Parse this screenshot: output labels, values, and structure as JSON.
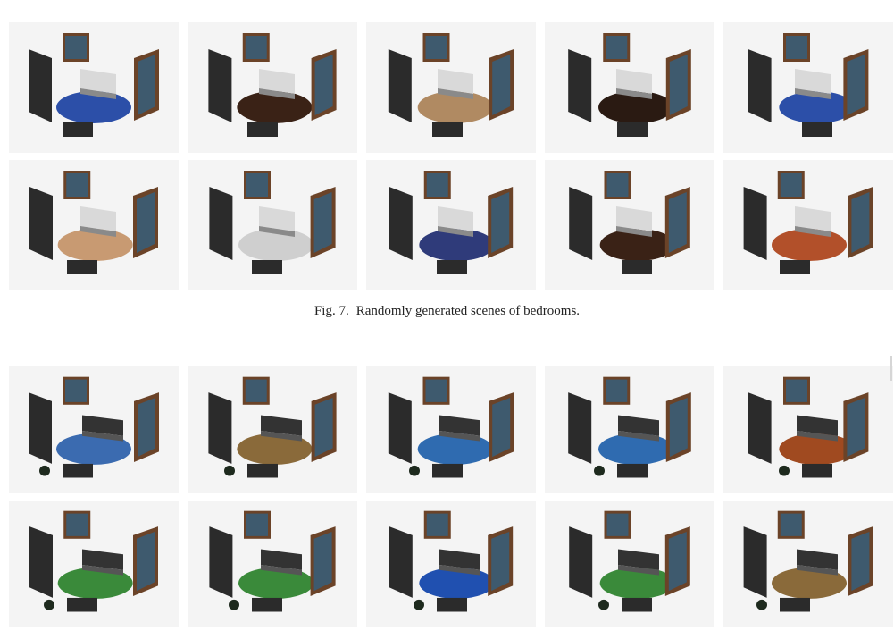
{
  "figure7": {
    "label": "Fig. 7.",
    "caption": "Randomly generated scenes of bedrooms.",
    "thumbnails": [
      {
        "scene": "bedroom",
        "rug": "#2c4fa8"
      },
      {
        "scene": "bedroom",
        "rug": "#3a2216"
      },
      {
        "scene": "bedroom",
        "rug": "#b08a62"
      },
      {
        "scene": "bedroom",
        "rug": "#2a1a12"
      },
      {
        "scene": "bedroom",
        "rug": "#2c4fa8"
      },
      {
        "scene": "bedroom",
        "rug": "#c89a72"
      },
      {
        "scene": "bedroom",
        "rug": "#cfcfcf"
      },
      {
        "scene": "bedroom",
        "rug": "#2f3b7a"
      },
      {
        "scene": "bedroom",
        "rug": "#3a2216"
      },
      {
        "scene": "bedroom",
        "rug": "#b2502a"
      }
    ]
  },
  "figure8": {
    "thumbnails": [
      {
        "scene": "living-room",
        "rug": "#3b6bb0"
      },
      {
        "scene": "living-room",
        "rug": "#8a6a3a"
      },
      {
        "scene": "living-room",
        "rug": "#2f6bb0"
      },
      {
        "scene": "living-room",
        "rug": "#2f6bb0"
      },
      {
        "scene": "living-room",
        "rug": "#a04a20"
      },
      {
        "scene": "living-room",
        "rug": "#3a8a3a"
      },
      {
        "scene": "living-room",
        "rug": "#3a8a3a"
      },
      {
        "scene": "living-room",
        "rug": "#2050b0"
      },
      {
        "scene": "living-room",
        "rug": "#3a8a3a"
      },
      {
        "scene": "living-room",
        "rug": "#8a6a3a"
      }
    ]
  }
}
